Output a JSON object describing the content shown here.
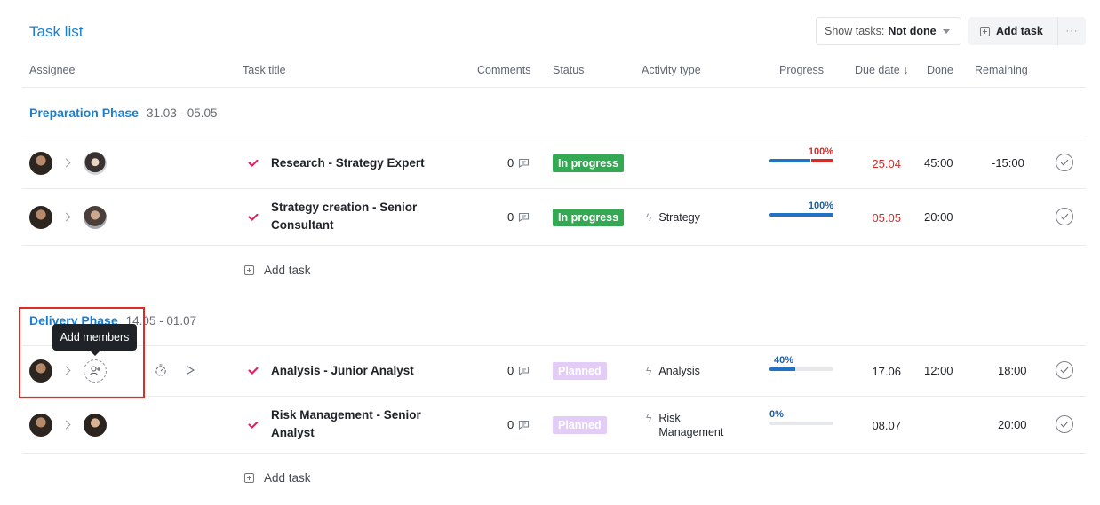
{
  "header": {
    "title": "Task list",
    "filter_label": "Show tasks:",
    "filter_value": "Not done",
    "add_task_label": "Add task",
    "more_label": "···"
  },
  "columns": {
    "assignee": "Assignee",
    "task_title": "Task title",
    "comments": "Comments",
    "status": "Status",
    "activity_type": "Activity type",
    "progress": "Progress",
    "due_date": "Due date ↓",
    "done": "Done",
    "remaining": "Remaining"
  },
  "phases": [
    {
      "name": "Preparation Phase",
      "dates": "31.03 - 05.05",
      "add_task_label": "Add task",
      "tasks": [
        {
          "title_lines": [
            "Research - Strategy Expert"
          ],
          "comments": "0",
          "status": "In progress",
          "activity_lines": [],
          "progress_label": "100%",
          "progress_value": 1.0,
          "progress_overrun": true,
          "due": "25.04",
          "due_overdue": true,
          "done": "45:00",
          "remaining": "-15:00"
        },
        {
          "title_lines": [
            "Strategy creation - Senior",
            "Consultant"
          ],
          "comments": "0",
          "status": "In progress",
          "activity_lines": [
            "Strategy"
          ],
          "progress_label": "100%",
          "progress_value": 1.0,
          "progress_overrun": false,
          "due": "05.05",
          "due_overdue": true,
          "done": "20:00",
          "remaining": ""
        }
      ]
    },
    {
      "name": "Delivery Phase",
      "dates": "14.05 - 01.07",
      "add_task_label": "Add task",
      "tasks": [
        {
          "title_lines": [
            "Analysis - Junior Analyst"
          ],
          "comments": "0",
          "status": "Planned",
          "activity_lines": [
            "Analysis"
          ],
          "progress_label": "40%",
          "progress_value": 0.4,
          "progress_overrun": false,
          "due": "17.06",
          "due_overdue": false,
          "done": "12:00",
          "remaining": "18:00"
        },
        {
          "title_lines": [
            "Risk Management - Senior",
            "Analyst"
          ],
          "comments": "0",
          "status": "Planned",
          "activity_lines": [
            "Risk",
            "Management"
          ],
          "progress_label": "0%",
          "progress_value": 0.0,
          "progress_overrun": false,
          "due": "08.07",
          "due_overdue": false,
          "done": "",
          "remaining": "20:00"
        }
      ]
    }
  ],
  "tooltip": "Add members",
  "colors": {
    "accent": "#1a7fd1",
    "status_in_progress": "#34a853",
    "status_planned": "#e3cdf6",
    "overdue": "#d52b2b",
    "progress_fill": "#1f72c4",
    "check_red": "#e0245e",
    "highlight": "#e02b2b"
  },
  "icons": {
    "assignee_chevron": "chevron-right-icon",
    "comment": "comment-icon",
    "activity": "bolt-icon",
    "done": "check-circle-icon",
    "add_member": "add-member-icon",
    "timer": "timer-icon",
    "play": "play-icon"
  }
}
